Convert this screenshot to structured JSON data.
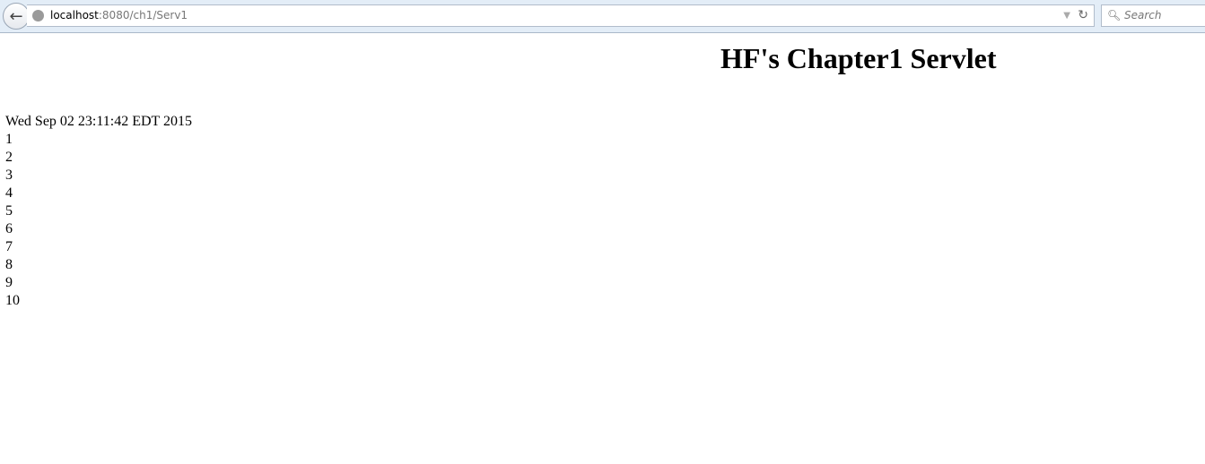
{
  "browser": {
    "url_host": "localhost",
    "url_path": ":8080/ch1/Serv1",
    "search_placeholder": "Search"
  },
  "page": {
    "heading": "HF's Chapter1 Servlet",
    "date": "Wed Sep 02 23:11:42 EDT 2015",
    "numbers": [
      "1",
      "2",
      "3",
      "4",
      "5",
      "6",
      "7",
      "8",
      "9",
      "10"
    ]
  }
}
